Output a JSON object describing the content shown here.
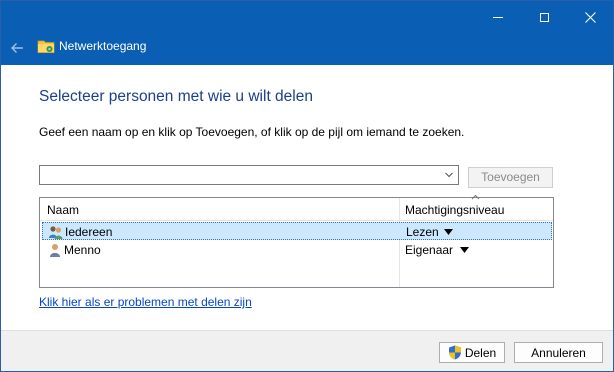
{
  "window": {
    "title": "Netwerktoegang"
  },
  "content": {
    "heading": "Selecteer personen met wie u wilt delen",
    "instruction": "Geef een naam op en klik op Toevoegen, of klik op de pijl om iemand te zoeken.",
    "name_input_value": "",
    "add_button_label": "Toevoegen"
  },
  "list": {
    "columns": [
      "Naam",
      "Machtigingsniveau"
    ],
    "rows": [
      {
        "name": "Iedereen",
        "permission": "Lezen",
        "icon": "users-group-icon",
        "selected": true
      },
      {
        "name": "Menno",
        "permission": "Eigenaar",
        "icon": "user-icon",
        "selected": false
      }
    ]
  },
  "help_link": "Klik hier als er problemen met delen zijn",
  "footer": {
    "share_button": "Delen",
    "cancel_button": "Annuleren"
  },
  "colors": {
    "titlebar": "#0a5fb4",
    "heading": "#1b3f8b",
    "selection": "#cce8ff",
    "link": "#0645c8"
  }
}
